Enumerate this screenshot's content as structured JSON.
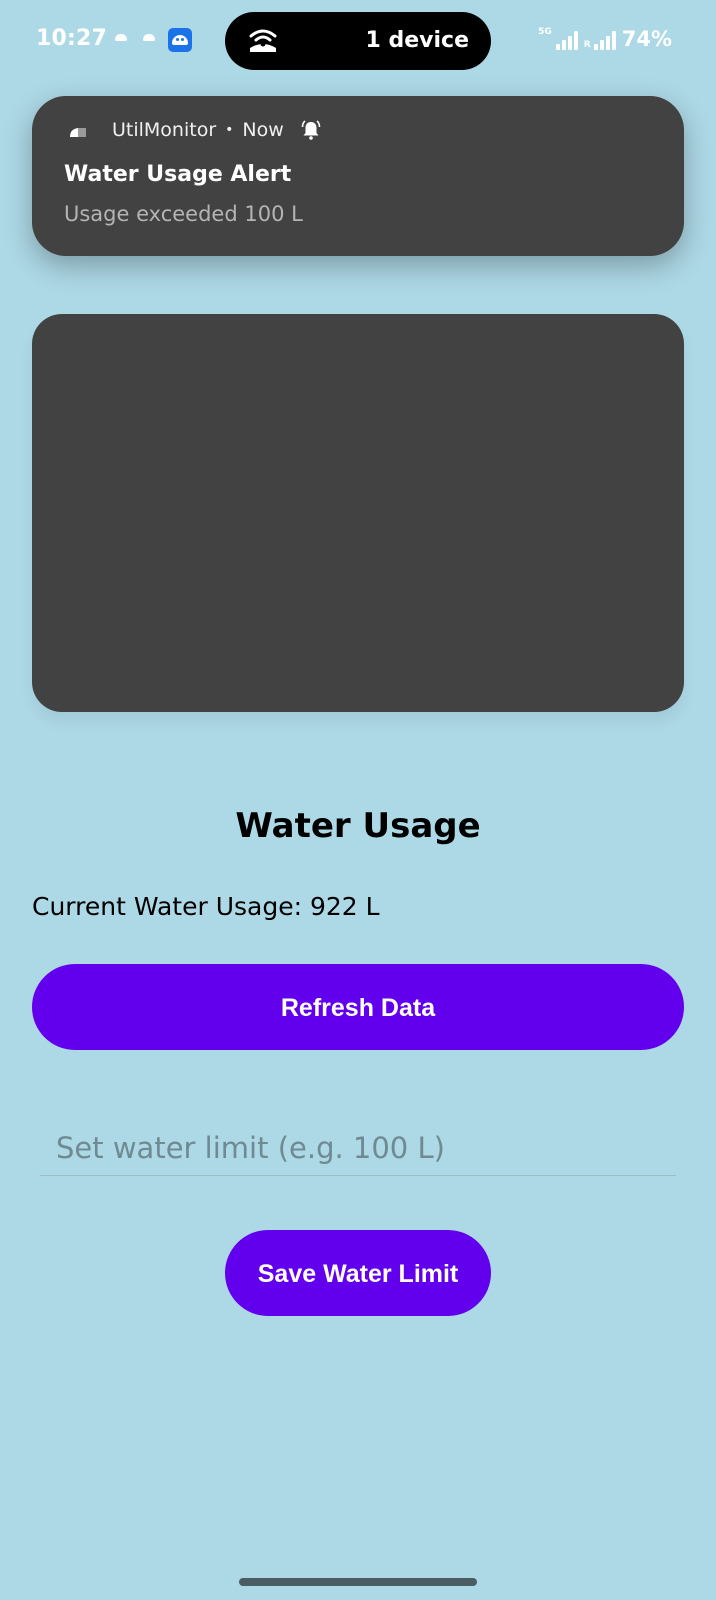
{
  "status_bar": {
    "time": "10:27",
    "pill_text": "1 device",
    "network_label": "5G",
    "roaming_label": "R",
    "battery": "74%"
  },
  "notification": {
    "app_name": "UtilMonitor",
    "separator": "•",
    "time": "Now",
    "title": "Water Usage Alert",
    "body": "Usage exceeded 100 L"
  },
  "main": {
    "title": "Water Usage",
    "current_usage_text": "Current Water Usage: 922 L",
    "refresh_button_label": "Refresh Data",
    "limit_input_placeholder": "Set water limit (e.g. 100 L)",
    "limit_input_value": "",
    "save_button_label": "Save Water Limit"
  },
  "colors": {
    "background": "#add8e6",
    "primary_button": "#6200ee",
    "dark_panel": "#424242"
  }
}
